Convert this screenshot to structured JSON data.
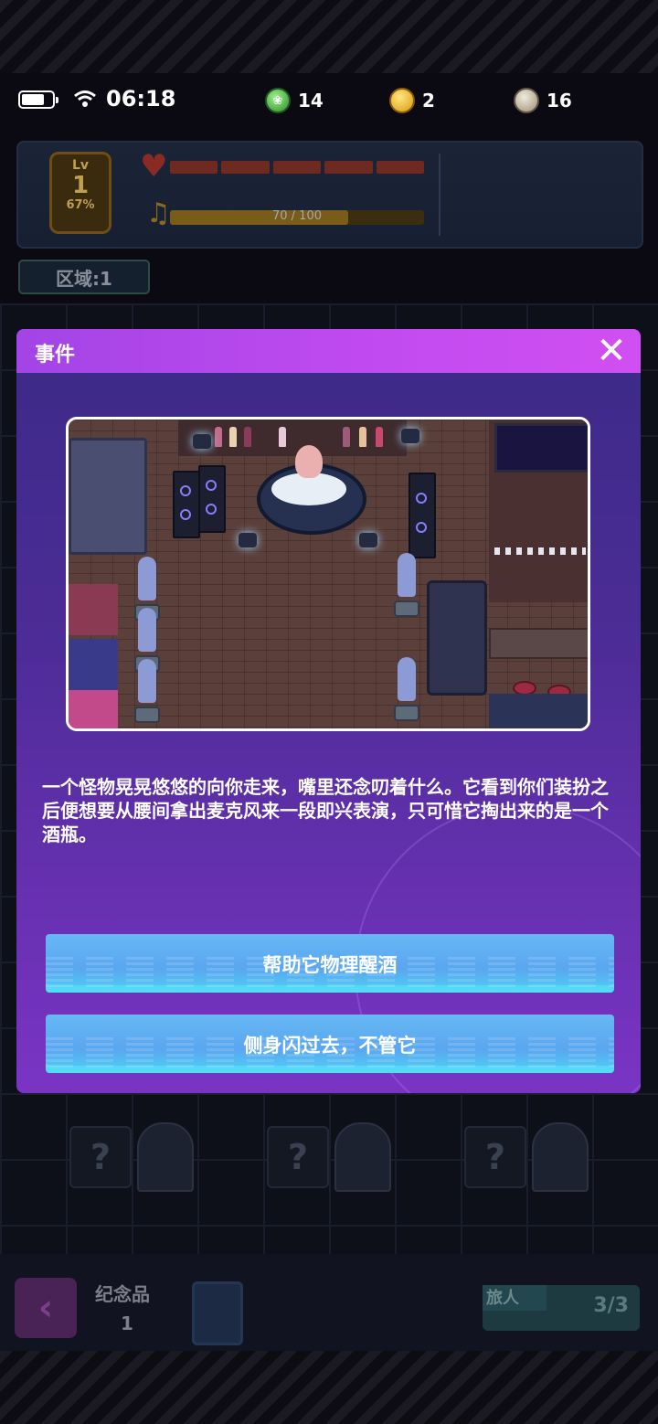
{
  "status_bar": {
    "time": "06:18",
    "resources": [
      {
        "name": "leaf-coin",
        "value": "14",
        "color": "#43b43a"
      },
      {
        "name": "gold-coin",
        "value": "2",
        "color": "#e8b023"
      },
      {
        "name": "silver-coin",
        "value": "16",
        "color": "#b8ad95"
      }
    ]
  },
  "hud": {
    "level_label": "Lv",
    "level": "1",
    "level_percent": "67%",
    "xp_text": "70 / 100",
    "xp_fraction": 0.7,
    "zone_label": "区域:1"
  },
  "board": {
    "mystery_tile": "?"
  },
  "bottom_bar": {
    "souvenir_label": "纪念品",
    "souvenir_count": "1",
    "traveler_label": "旅人",
    "traveler_value": "3/3"
  },
  "modal": {
    "title": "事件",
    "close_icon": "close-icon",
    "description": "一个怪物晃晃悠悠的向你走来，嘴里还念叨着什么。它看到你们装扮之后便想要从腰间拿出麦克风来一段即兴表演，只可惜它掏出来的是一个酒瓶。",
    "choices": [
      {
        "label": "帮助它物理醒酒"
      },
      {
        "label": "侧身闪过去，不管它"
      }
    ]
  },
  "colors": {
    "modal_header": "#c24bf0",
    "modal_body": "#4c2c96",
    "choice_button": "#5aa6f0"
  }
}
